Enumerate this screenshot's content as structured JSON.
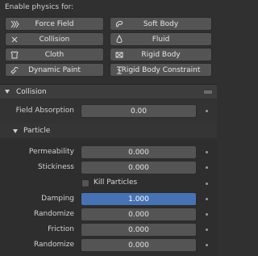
{
  "enable_physics": {
    "label": "Enable physics for:",
    "buttons": [
      {
        "label": "Force Field",
        "icon": "force-field-icon"
      },
      {
        "label": "Soft Body",
        "icon": "soft-body-icon"
      },
      {
        "label": "Collision",
        "icon": "collision-icon"
      },
      {
        "label": "Fluid",
        "icon": "fluid-icon"
      },
      {
        "label": "Cloth",
        "icon": "cloth-icon"
      },
      {
        "label": "Rigid Body",
        "icon": "rigid-body-icon"
      },
      {
        "label": "Dynamic Paint",
        "icon": "dynamic-paint-icon"
      },
      {
        "label": "Rigid Body Constraint",
        "icon": "rigid-body-constraint-icon"
      }
    ]
  },
  "collision": {
    "title": "Collision",
    "field_absorption": {
      "label": "Field Absorption",
      "value": "0.00"
    },
    "particle": {
      "title": "Particle",
      "permeability": {
        "label": "Permeability",
        "value": "0.000"
      },
      "stickiness": {
        "label": "Stickiness",
        "value": "0.000"
      },
      "kill_particles": {
        "label": "Kill Particles",
        "checked": false
      },
      "damping": {
        "label": "Damping",
        "value": "1.000"
      },
      "damping_randomize": {
        "label": "Randomize",
        "value": "0.000"
      },
      "friction": {
        "label": "Friction",
        "value": "0.000"
      },
      "friction_randomize": {
        "label": "Randomize",
        "value": "0.000"
      }
    }
  },
  "colors": {
    "background": "#303030",
    "button": "#545454",
    "accent": "#4772b3"
  }
}
